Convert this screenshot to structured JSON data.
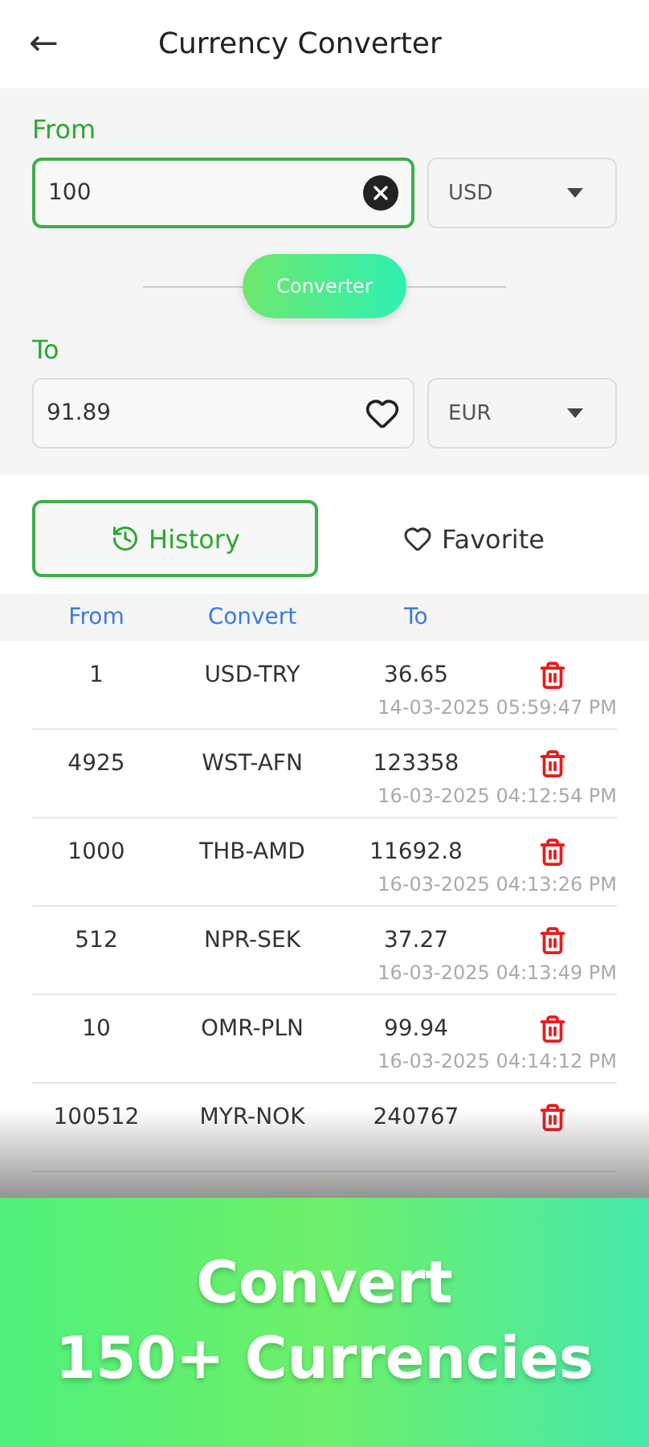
{
  "header": {
    "back": "←",
    "title": "Currency Converter"
  },
  "converter": {
    "from_label": "From",
    "from_value": "100",
    "from_currency": "USD",
    "button": "Converter",
    "to_label": "To",
    "to_value": "91.89",
    "to_currency": "EUR"
  },
  "tabs": [
    {
      "label": "History",
      "selected": true
    },
    {
      "label": "Favorite",
      "selected": false
    }
  ],
  "table": {
    "columns": [
      "From",
      "Convert",
      "To"
    ],
    "rows": [
      {
        "from": "1",
        "pair": "USD-TRY",
        "to": "36.65",
        "date": "14-03-2025 05:59:47 PM"
      },
      {
        "from": "4925",
        "pair": "WST-AFN",
        "to": "123358",
        "date": "16-03-2025 04:12:54 PM"
      },
      {
        "from": "1000",
        "pair": "THB-AMD",
        "to": "11692.8",
        "date": "16-03-2025 04:13:26 PM"
      },
      {
        "from": "512",
        "pair": "NPR-SEK",
        "to": "37.27",
        "date": "16-03-2025 04:13:49 PM"
      },
      {
        "from": "10",
        "pair": "OMR-PLN",
        "to": "99.94",
        "date": "16-03-2025 04:14:12 PM"
      },
      {
        "from": "100512",
        "pair": "MYR-NOK",
        "to": "240767"
      }
    ]
  },
  "banner": {
    "lines": [
      "Convert",
      "150+ Currencies"
    ]
  }
}
